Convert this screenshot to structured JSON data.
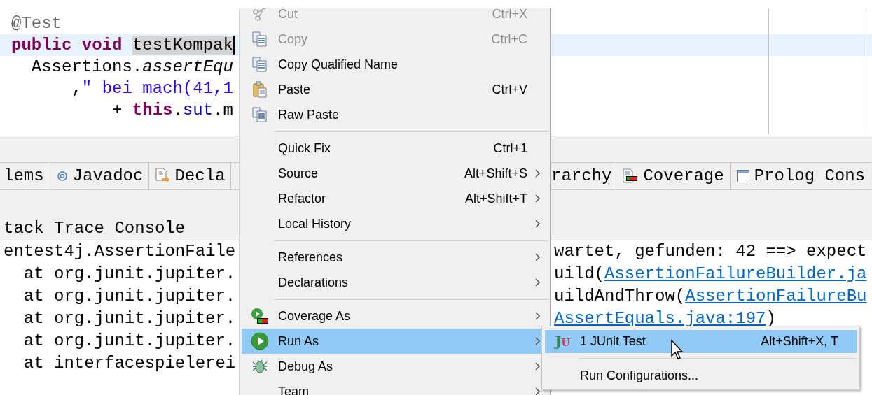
{
  "editor": {
    "lines": [
      {
        "current": false,
        "segments": [
          {
            "text": "@Test",
            "kind": "annotation"
          }
        ]
      },
      {
        "current": true,
        "segments": [
          {
            "text": "public void",
            "kind": "keyword"
          },
          {
            "text": "testKompak",
            "kind": "selection"
          }
        ]
      },
      {
        "current": false,
        "segments": [
          {
            "text": "  Assertions.",
            "kind": "plain"
          },
          {
            "text": "assertEqu",
            "kind": "italic"
          }
        ]
      },
      {
        "current": false,
        "segments": [
          {
            "text": "      ,",
            "kind": "plain"
          },
          {
            "text": "\" bei mach(41,1",
            "kind": "string"
          }
        ]
      },
      {
        "current": false,
        "segments": [
          {
            "text": "          + ",
            "kind": "plain"
          },
          {
            "text": "this",
            "kind": "keyword"
          },
          {
            "text": ".",
            "kind": "plain"
          },
          {
            "text": "sut",
            "kind": "field"
          },
          {
            "text": ".m",
            "kind": "plain"
          }
        ]
      }
    ]
  },
  "view_tabs": {
    "left": [
      {
        "label": "lems",
        "kind": "plain"
      },
      {
        "label": "Javadoc",
        "kind": "javadoc"
      },
      {
        "label": "Decla",
        "kind": "declaration"
      }
    ],
    "right": [
      {
        "label": "rarchy",
        "kind": "plain"
      },
      {
        "label": "Coverage",
        "kind": "coverage"
      },
      {
        "label": "Prolog Cons",
        "kind": "console"
      }
    ]
  },
  "console": {
    "title": "tack Trace Console",
    "lines": [
      {
        "left": "entest4j.AssertionFaile",
        "right": [
          {
            "text": "wartet, gefunden: 42 ==> expect",
            "kind": "text"
          }
        ]
      },
      {
        "left": "  at org.junit.jupiter.",
        "right": [
          {
            "text": "uild(",
            "kind": "text"
          },
          {
            "text": "AssertionFailureBuilder.ja",
            "kind": "link"
          }
        ]
      },
      {
        "left": "  at org.junit.jupiter.",
        "right": [
          {
            "text": "uildAndThrow(",
            "kind": "text"
          },
          {
            "text": "AssertionFailureBu",
            "kind": "link"
          }
        ]
      },
      {
        "left": "  at org.junit.jupiter.",
        "right": [
          {
            "text": "AssertEquals.java:197",
            "kind": "link"
          },
          {
            "text": ")",
            "kind": "text"
          }
        ]
      },
      {
        "left": "  at org.junit.jupiter."
      },
      {
        "left": "  at interfacespielerei"
      }
    ]
  },
  "context_menu": {
    "groups": [
      [
        {
          "kind": "scissors",
          "label": "Cut",
          "shortcut": "Ctrl+X",
          "disabled": true,
          "submenu": false,
          "selected": false
        },
        {
          "kind": "copy",
          "label": "Copy",
          "shortcut": "Ctrl+C",
          "disabled": true,
          "submenu": false,
          "selected": false
        },
        {
          "kind": "copy",
          "label": "Copy Qualified Name",
          "disabled": false,
          "submenu": false,
          "selected": false
        },
        {
          "kind": "paste",
          "label": "Paste",
          "shortcut": "Ctrl+V",
          "disabled": false,
          "submenu": false,
          "selected": false
        },
        {
          "kind": "copy",
          "label": "Raw Paste",
          "disabled": false,
          "submenu": false,
          "selected": false
        }
      ],
      [
        {
          "kind": "plain",
          "label": "Quick Fix",
          "shortcut": "Ctrl+1",
          "disabled": false,
          "submenu": false,
          "selected": false
        },
        {
          "kind": "plain",
          "label": "Source",
          "shortcut": "Alt+Shift+S",
          "disabled": false,
          "submenu": true,
          "selected": false
        },
        {
          "kind": "plain",
          "label": "Refactor",
          "shortcut": "Alt+Shift+T",
          "disabled": false,
          "submenu": true,
          "selected": false
        },
        {
          "kind": "plain",
          "label": "Local History",
          "disabled": false,
          "submenu": true,
          "selected": false
        }
      ],
      [
        {
          "kind": "plain",
          "label": "References",
          "disabled": false,
          "submenu": true,
          "selected": false
        },
        {
          "kind": "plain",
          "label": "Declarations",
          "disabled": false,
          "submenu": true,
          "selected": false
        }
      ],
      [
        {
          "kind": "coverage",
          "label": "Coverage As",
          "disabled": false,
          "submenu": true,
          "selected": false
        },
        {
          "kind": "run",
          "label": "Run As",
          "disabled": false,
          "submenu": true,
          "selected": true
        },
        {
          "kind": "bug",
          "label": "Debug As",
          "disabled": false,
          "submenu": true,
          "selected": false
        },
        {
          "kind": "plain",
          "label": "Team",
          "disabled": false,
          "submenu": true,
          "selected": false
        }
      ]
    ]
  },
  "submenu": {
    "groups": [
      [
        {
          "kind": "junit",
          "icon_text": "JU",
          "label": "1 JUnit Test",
          "shortcut": "Alt+Shift+X, T",
          "selected": true
        }
      ],
      [
        {
          "kind": "plain",
          "label": "Run Configurations...",
          "selected": false
        }
      ]
    ]
  }
}
